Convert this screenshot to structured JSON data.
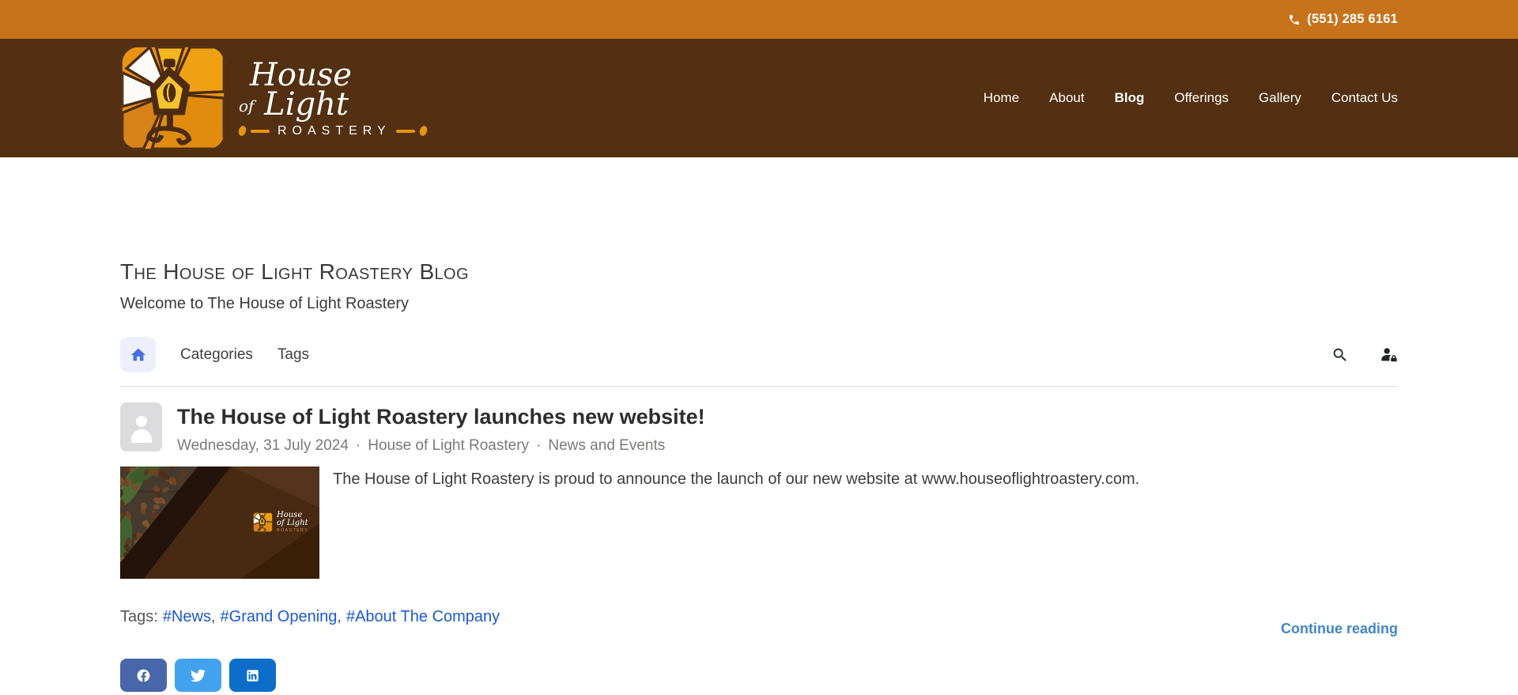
{
  "topbar": {
    "phone": "(551) 285 6161"
  },
  "header": {
    "brand": {
      "house": "House",
      "of": "of",
      "light": "Light",
      "roastery": "ROASTERY"
    },
    "nav": [
      "Home",
      "About",
      "Blog",
      "Offerings",
      "Gallery",
      "Contact Us"
    ],
    "active_item": "Blog"
  },
  "page": {
    "title": "The House of Light Roastery Blog",
    "subtitle": "Welcome to The House of Light Roastery"
  },
  "blog_nav": {
    "items": [
      "Categories",
      "Tags"
    ]
  },
  "post": {
    "title": "The House of Light Roastery launches new website!",
    "date": "Wednesday, 31 July 2024",
    "author": "House of Light Roastery",
    "category": "News and Events",
    "meta_separator": "·",
    "body": "The House of Light Roastery is proud to announce the launch of our new website at www.houseoflightroastery.com.",
    "tags_label": "Tags:",
    "tags": [
      "#News",
      "#Grand Opening",
      "#About The Company"
    ],
    "tag_separator": ",",
    "continue_label": "Continue reading"
  },
  "colors": {
    "topbar_bg": "#C7731B",
    "header_bg": "#533012",
    "logo_gold": "#E89412",
    "home_btn_bg": "#edf0fb",
    "home_icon": "#4a6fdc",
    "tag_link": "#1b59d2",
    "continue_link": "#3f86c8",
    "facebook": "#4867aa",
    "twitter": "#42a2ee",
    "linkedin": "#0d6ec9"
  }
}
